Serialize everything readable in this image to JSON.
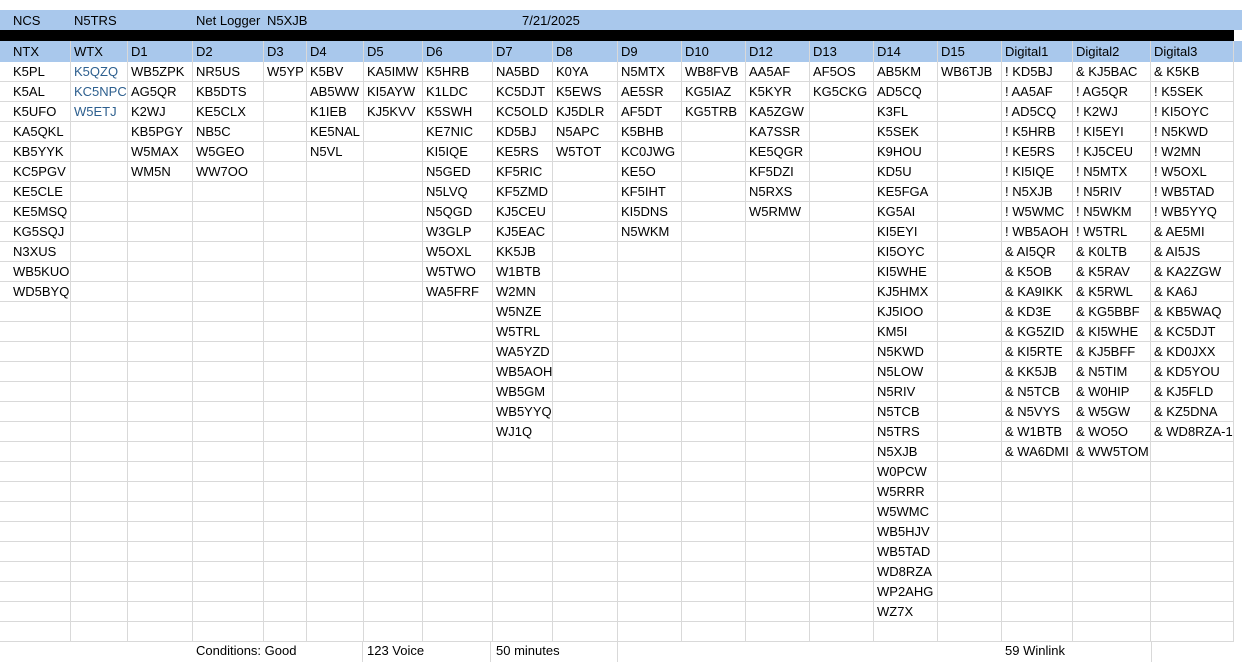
{
  "top": {
    "ncs_label": "NCS",
    "ncs_value": "N5TRS",
    "logger_label": "Net Logger",
    "logger_value": "N5XJB",
    "date": "7/21/2025"
  },
  "columns": [
    {
      "header": "NTX",
      "calls": [
        "K5PL",
        "K5AL",
        "K5UFO",
        "KA5QKL",
        "KB5YYK",
        "KC5PGV",
        "KE5CLE",
        "KE5MSQ",
        "KG5SQJ",
        "N3XUS",
        "WB5KUO",
        "WD5BYQ"
      ]
    },
    {
      "header": "WTX",
      "calls": [
        "K5QZQ",
        "KC5NPC",
        "W5ETJ"
      ],
      "text_color": "#2d5f8e"
    },
    {
      "header": "D1",
      "calls": [
        "WB5ZPK",
        "AG5QR",
        "K2WJ",
        "KB5PGY",
        "W5MAX",
        "WM5N"
      ]
    },
    {
      "header": "D2",
      "calls": [
        "NR5US",
        "KB5DTS",
        "KE5CLX",
        "NB5C",
        "W5GEO",
        "WW7OO"
      ]
    },
    {
      "header": "D3",
      "calls": [
        "W5YP"
      ]
    },
    {
      "header": "D4",
      "calls": [
        "K5BV",
        "AB5WW",
        "K1IEB",
        "KE5NAL",
        "N5VL"
      ]
    },
    {
      "header": "D5",
      "calls": [
        "KA5IMW",
        "KI5AYW",
        "KJ5KVV"
      ]
    },
    {
      "header": "D6",
      "calls": [
        "K5HRB",
        "K1LDC",
        "K5SWH",
        "KE7NIC",
        "KI5IQE",
        "N5GED",
        "N5LVQ",
        "N5QGD",
        "W3GLP",
        "W5OXL",
        "W5TWO",
        "WA5FRF"
      ]
    },
    {
      "header": "D7",
      "calls": [
        "NA5BD",
        "KC5DJT",
        "KC5OLD",
        "KD5BJ",
        "KE5RS",
        "KF5RIC",
        "KF5ZMD",
        "KJ5CEU",
        "KJ5EAC",
        "KK5JB",
        "W1BTB",
        "W2MN",
        "W5NZE",
        "W5TRL",
        "WA5YZD",
        "WB5AOH",
        "WB5GM",
        "WB5YYQ",
        "WJ1Q"
      ]
    },
    {
      "header": "D8",
      "calls": [
        "K0YA",
        "K5EWS",
        "KJ5DLR",
        "N5APC",
        "W5TOT"
      ]
    },
    {
      "header": "D9",
      "calls": [
        "N5MTX",
        "AE5SR",
        "AF5DT",
        "K5BHB",
        "KC0JWG",
        "KE5O",
        "KF5IHT",
        "KI5DNS",
        "N5WKM"
      ]
    },
    {
      "header": "D10",
      "calls": [
        "WB8FVB",
        "KG5IAZ",
        "KG5TRB"
      ]
    },
    {
      "header": "D12",
      "calls": [
        "AA5AF",
        "K5KYR",
        "KA5ZGW",
        "KA7SSR",
        "KE5QGR",
        "KF5DZI",
        "N5RXS",
        "W5RMW"
      ]
    },
    {
      "header": "D13",
      "calls": [
        "AF5OS",
        "KG5CKG"
      ]
    },
    {
      "header": "D14",
      "calls": [
        "AB5KM",
        "AD5CQ",
        "K3FL",
        "K5SEK",
        "K9HOU",
        "KD5U",
        "KE5FGA",
        "KG5AI",
        "KI5EYI",
        "KI5OYC",
        "KI5WHE",
        "KJ5HMX",
        "KJ5IOO",
        "KM5I",
        "N5KWD",
        "N5LOW",
        "N5RIV",
        "N5TCB",
        "N5TRS",
        "N5XJB",
        "W0PCW",
        "W5RRR",
        "W5WMC",
        "WB5HJV",
        "WB5TAD",
        "WD8RZA",
        "WP2AHG",
        "WZ7X"
      ]
    },
    {
      "header": "D15",
      "calls": [
        "WB6TJB"
      ]
    },
    {
      "header": "Digital1",
      "calls": [
        "! KD5BJ",
        "! AA5AF",
        "! AD5CQ",
        "! K5HRB",
        "! KE5RS",
        "! KI5IQE",
        "! N5XJB",
        "! W5WMC",
        "! WB5AOH",
        "& AI5QR",
        "& K5OB",
        "& KA9IKK",
        "& KD3E",
        "& KG5ZID",
        "& KI5RTE",
        "& KK5JB",
        "& N5TCB",
        "& N5VYS",
        "& W1BTB",
        "& WA6DMI"
      ]
    },
    {
      "header": "Digital2",
      "calls": [
        "& KJ5BAC",
        "! AG5QR",
        "! K2WJ",
        "! KI5EYI",
        "! KJ5CEU",
        "! N5MTX",
        "! N5RIV",
        "! N5WKM",
        "! W5TRL",
        "& K0LTB",
        "& K5RAV",
        "& K5RWL",
        "& KG5BBF",
        "& KI5WHE",
        "& KJ5BFF",
        "& N5TIM",
        "& W0HIP",
        "& W5GW",
        "& WO5O",
        "& WW5TOM"
      ]
    },
    {
      "header": "Digital3",
      "calls": [
        "& K5KB",
        "! K5SEK",
        "! KI5OYC",
        "! N5KWD",
        "! W2MN",
        "! W5OXL",
        "! WB5TAD",
        "! WB5YYQ",
        "& AE5MI",
        "& AI5JS",
        "& KA2ZGW",
        "& KA6J",
        "& KB5WAQ",
        "& KC5DJT",
        "& KD0JXX",
        "& KD5YOU",
        "& KJ5FLD",
        "& KZ5DNA",
        "& WD8RZA-1"
      ]
    }
  ],
  "footer": {
    "conditions": "Conditions: Good",
    "voice": "123 Voice",
    "duration": "50 minutes",
    "winlink": "59 Winlink"
  }
}
